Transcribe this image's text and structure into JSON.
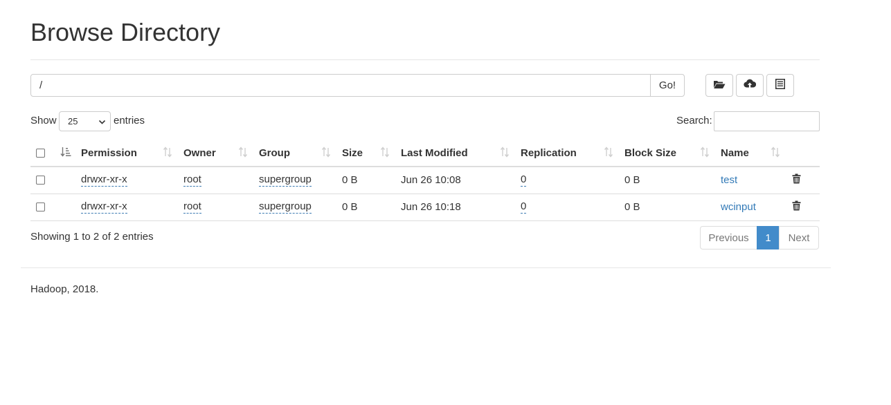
{
  "page": {
    "title": "Browse Directory"
  },
  "toolbar": {
    "path_value": "/",
    "go_label": "Go!",
    "buttons": [
      {
        "icon": "folder-open-icon"
      },
      {
        "icon": "cloud-upload-icon"
      },
      {
        "icon": "list-alt-icon"
      }
    ]
  },
  "controls": {
    "show_label": "Show",
    "entries_value": "25",
    "entries_label": "entries",
    "search_label": "Search:",
    "search_value": ""
  },
  "table": {
    "columns": [
      "Permission",
      "Owner",
      "Group",
      "Size",
      "Last Modified",
      "Replication",
      "Block Size",
      "Name"
    ],
    "rows": [
      {
        "permission": "drwxr-xr-x",
        "owner": "root",
        "group": "supergroup",
        "size": "0 B",
        "modified": "Jun 26 10:08",
        "replication": "0",
        "block_size": "0 B",
        "name": "test"
      },
      {
        "permission": "drwxr-xr-x",
        "owner": "root",
        "group": "supergroup",
        "size": "0 B",
        "modified": "Jun 26 10:18",
        "replication": "0",
        "block_size": "0 B",
        "name": "wcinput"
      }
    ]
  },
  "info": {
    "text": "Showing 1 to 2 of 2 entries"
  },
  "pagination": {
    "previous": "Previous",
    "current": "1",
    "next": "Next"
  },
  "footer": {
    "text": "Hadoop, 2018."
  },
  "colors": {
    "link": "#337ab7",
    "active_page": "#428bca",
    "border": "#dddddd"
  }
}
